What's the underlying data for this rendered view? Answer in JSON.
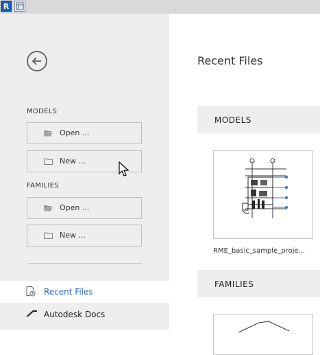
{
  "titlebar": {
    "app_logo_text": "R",
    "icons": [
      "revit-logo-icon",
      "panel-icon"
    ]
  },
  "sidebar": {
    "back_icon": "arrow-left-circle-icon",
    "models": {
      "label": "MODELS",
      "open_label": "Open ...",
      "new_label": "New ..."
    },
    "families": {
      "label": "FAMILIES",
      "open_label": "Open ...",
      "new_label": "New ..."
    },
    "nav": [
      {
        "label": "Recent Files",
        "icon": "recent-files-icon",
        "active": true
      },
      {
        "label": "Autodesk Docs",
        "icon": "autodesk-docs-icon",
        "active": false
      }
    ]
  },
  "main": {
    "title": "Recent Files",
    "models_section": {
      "label": "MODELS",
      "items": [
        {
          "caption": "RME_basic_sample_proje..."
        }
      ]
    },
    "families_section": {
      "label": "FAMILIES"
    }
  },
  "colors": {
    "sidebar_bg": "#eeeeee",
    "active_link": "#2c6dbb",
    "band_bg": "#eeeeee"
  }
}
